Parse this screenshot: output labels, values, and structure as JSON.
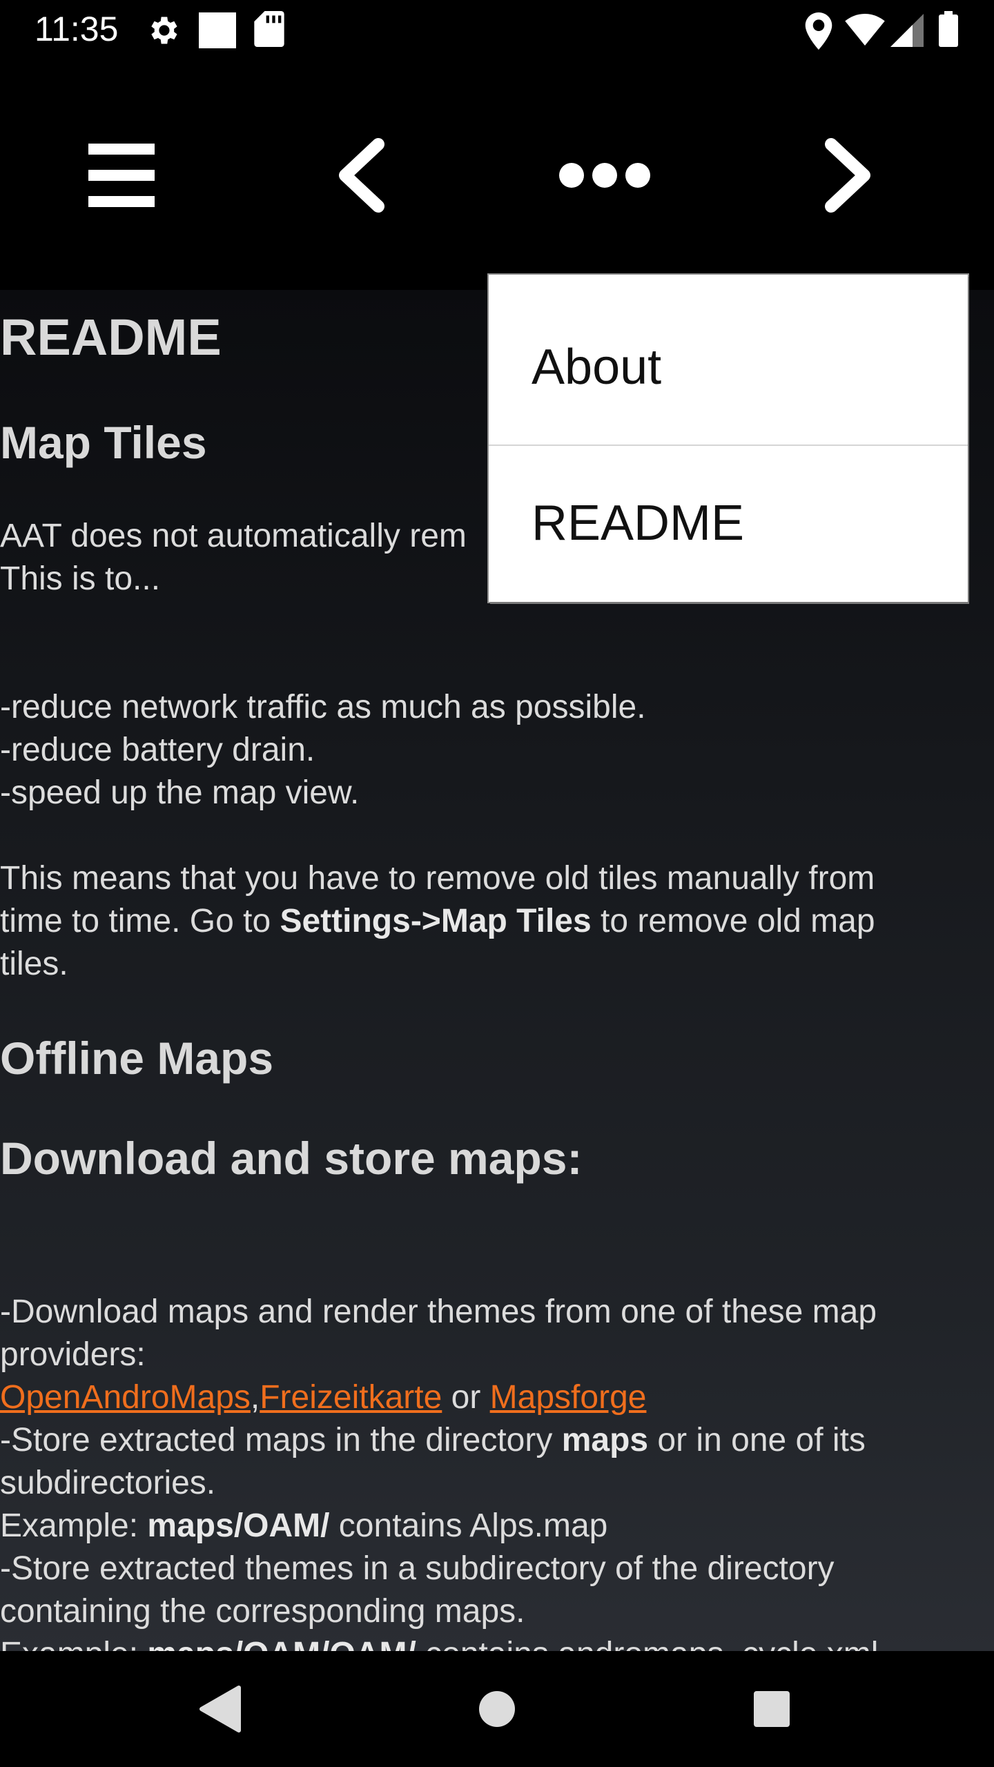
{
  "status_bar": {
    "time": "11:35",
    "icons_left": [
      "settings-gear-icon",
      "square-notification-icon",
      "sd-card-icon"
    ],
    "icons_right": [
      "location-icon",
      "wifi-icon",
      "signal-icon",
      "battery-icon"
    ]
  },
  "toolbar": {
    "buttons": [
      "menu-icon",
      "back-icon",
      "more-icon",
      "forward-icon"
    ]
  },
  "menu": {
    "items": [
      {
        "label": "About"
      },
      {
        "label": "README"
      }
    ]
  },
  "content": {
    "title": "README",
    "map_tiles_heading": "Map Tiles",
    "intro_line1": "AAT does not automatically rem",
    "intro_line2": "This is to...",
    "bullets": [
      "-reduce network traffic as much as possible.",
      "-reduce battery drain.",
      "-speed up the map view."
    ],
    "means_line1": "This means that you have to remove old tiles manually from",
    "means_line2_pre": "time to time. Go to ",
    "means_line2_bold": "Settings->Map Tiles",
    "means_line2_post": " to remove old map",
    "means_line3": "tiles.",
    "offline_heading": "Offline Maps",
    "download_heading": "Download and store maps:",
    "download_line1": "-Download maps and render themes from one of these map",
    "download_line2": "providers:",
    "link_openandromaps": "OpenAndroMaps",
    "link_comma": ",",
    "link_freizeitkarte": "Freizeitkarte",
    "link_or": " or ",
    "link_mapsforge": "Mapsforge",
    "store_line1_pre": "-Store extracted maps in the directory ",
    "store_line1_bold": "maps",
    "store_line1_post": " or in one of its",
    "store_line2": "subdirectories.",
    "example1_pre": "Example: ",
    "example1_bold": "maps/OAM/",
    "example1_post": " contains Alps.map",
    "themes_line1": "-Store extracted themes in a subdirectory of the directory",
    "themes_line2": "containing the corresponding maps.",
    "example2_pre": "Example: ",
    "example2_bold": "maps/OAM/OAM/",
    "example2_post": " contains andromaps_cycle.xml,"
  },
  "nav_bar": {
    "buttons": [
      "back-triangle-icon",
      "home-circle-icon",
      "recents-square-icon"
    ]
  },
  "colors": {
    "link": "#f06e1d",
    "text": "#dcdcdc",
    "menu_bg": "#ffffff"
  }
}
